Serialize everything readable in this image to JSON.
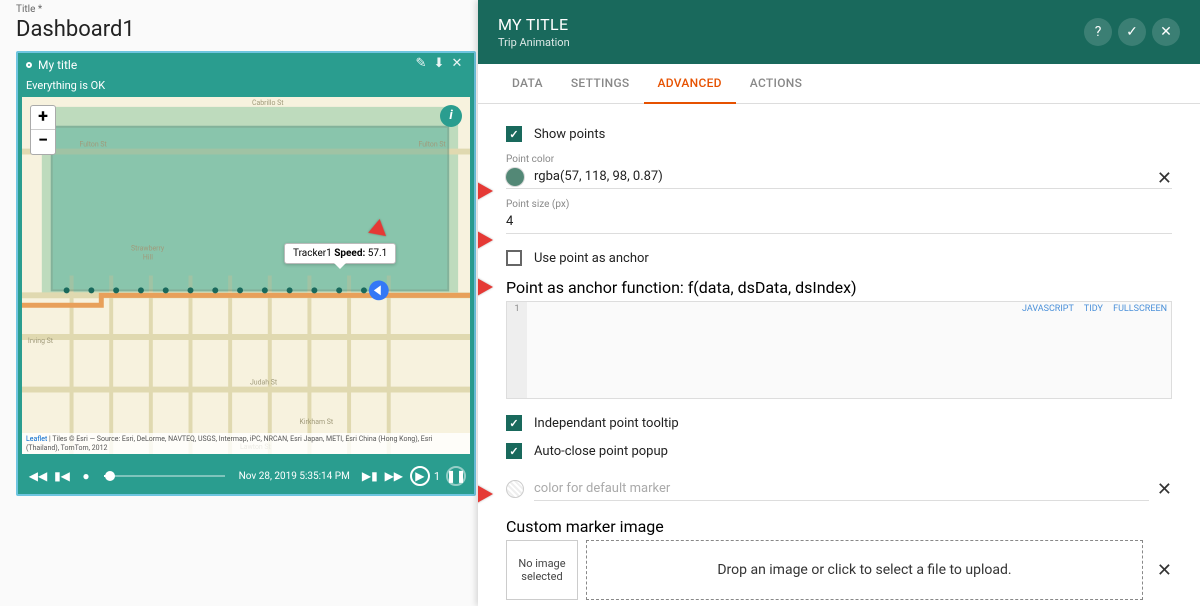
{
  "dashboard": {
    "title_label": "Title *",
    "title": "Dashboard1"
  },
  "widget": {
    "title": "My title",
    "status": "Everything is OK",
    "tooltip_device": "Tracker1",
    "tooltip_key": "Speed:",
    "tooltip_val": "57.1",
    "timestamp": "Nov 28, 2019 5:35:14 PM",
    "speed": "1",
    "attribution_lead": "Leaflet",
    "attribution": " | Tiles © Esri — Source: Esri, DeLorme, NAVTEQ, USGS, Intermap, iPC, NRCAN, Esri Japan, METI, Esri China (Hong Kong), Esri (Thailand), TomTom, 2012"
  },
  "panel": {
    "title": "MY TITLE",
    "subtitle": "Trip Animation",
    "tabs": {
      "data": "DATA",
      "settings": "SETTINGS",
      "advanced": "ADVANCED",
      "actions": "ACTIONS"
    },
    "show_points": "Show points",
    "point_color_label": "Point color",
    "point_color": "rgba(57, 118, 98, 0.87)",
    "point_size_label": "Point size (px)",
    "point_size": "4",
    "use_anchor": "Use point as anchor",
    "anchor_fn": "Point as anchor function: f(data, dsData, dsIndex)",
    "tool_js": "JAVASCRIPT",
    "tool_tidy": "TIDY",
    "tool_fs": "FULLSCREEN",
    "independent": "Independant point tooltip",
    "autoclose": "Auto-close point popup",
    "default_marker_ph": "color for default marker",
    "custom_img": "Custom marker image",
    "no_img": "No image selected",
    "drop": "Drop an image or click to select a file to upload."
  }
}
